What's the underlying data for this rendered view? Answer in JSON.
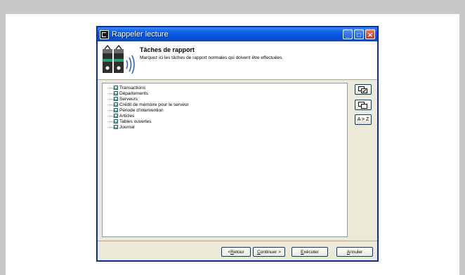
{
  "window": {
    "title": "Rappeler lecture",
    "controls": {
      "minimize": "_",
      "maximize": "□",
      "close": "✕"
    }
  },
  "header": {
    "title": "Tâches de rapport",
    "subtitle": "Marquez ici les tâches de rapport normales qui doivent être effectuées."
  },
  "tasks": [
    {
      "label": "Transactions",
      "checked": true
    },
    {
      "label": "Départements",
      "checked": true
    },
    {
      "label": "Serveurs",
      "checked": true
    },
    {
      "label": "Crédit de mémoire pour le serveur",
      "checked": true
    },
    {
      "label": "Période d'intervention",
      "checked": true
    },
    {
      "label": "Articles",
      "checked": true
    },
    {
      "label": "Tables ouvertes",
      "checked": true
    },
    {
      "label": "Journal",
      "checked": true
    }
  ],
  "side_buttons": {
    "select_all_icon": "check-all-icon",
    "deselect_all_icon": "uncheck-all-icon",
    "sort_label": "A > Z"
  },
  "footer": {
    "back": {
      "prefix": "< ",
      "accel": "R",
      "rest": "etour"
    },
    "next": {
      "accel": "C",
      "rest": "ontinuer >"
    },
    "execute": {
      "accel": "E",
      "rest": "xécuter"
    },
    "cancel": {
      "accel": "A",
      "rest": "nnuler"
    }
  },
  "colors": {
    "titlebar": "#0a5fe8",
    "window_bg": "#ece9d8",
    "close_button": "#c8381a"
  }
}
